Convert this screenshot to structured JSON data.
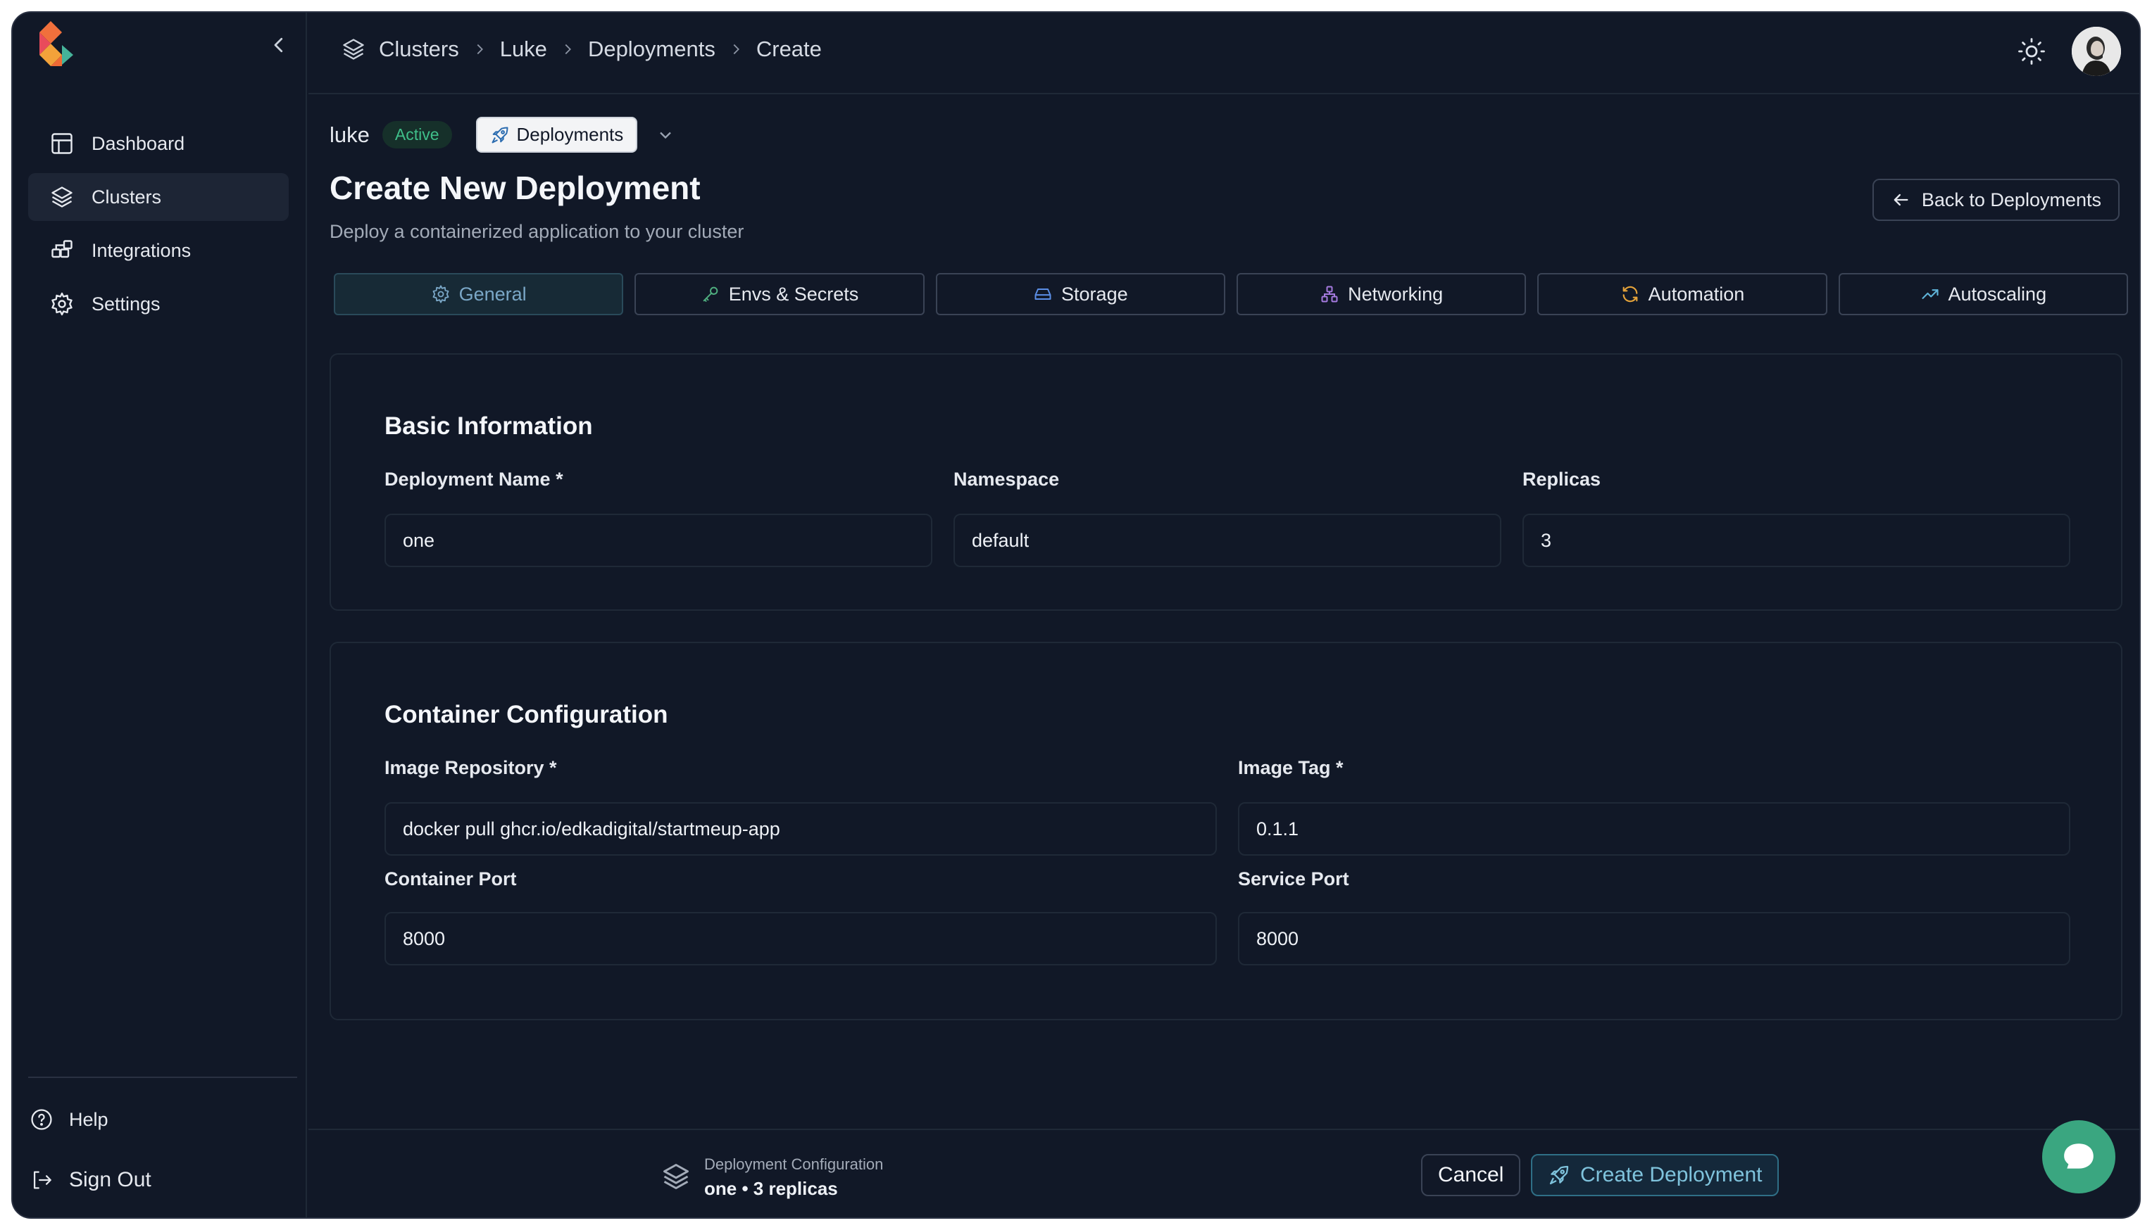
{
  "sidebar": {
    "items": [
      {
        "label": "Dashboard",
        "icon": "dashboard-icon"
      },
      {
        "label": "Clusters",
        "icon": "layers-icon",
        "active": true
      },
      {
        "label": "Integrations",
        "icon": "integrations-icon"
      },
      {
        "label": "Settings",
        "icon": "gear-icon"
      }
    ],
    "help_label": "Help",
    "signout_label": "Sign Out"
  },
  "breadcrumb": [
    "Clusters",
    "Luke",
    "Deployments",
    "Create"
  ],
  "header": {
    "cluster_name": "luke",
    "status_badge": "Active",
    "section_pill": "Deployments",
    "title": "Create New Deployment",
    "subtitle": "Deploy a containerized application to your cluster",
    "back_label": "Back to Deployments"
  },
  "tabs": [
    {
      "label": "General",
      "icon": "gear-icon",
      "active": true
    },
    {
      "label": "Envs & Secrets",
      "icon": "key-icon"
    },
    {
      "label": "Storage",
      "icon": "storage-icon"
    },
    {
      "label": "Networking",
      "icon": "network-icon"
    },
    {
      "label": "Automation",
      "icon": "refresh-icon"
    },
    {
      "label": "Autoscaling",
      "icon": "trending-up-icon"
    }
  ],
  "basic": {
    "title": "Basic Information",
    "deployment_name_label": "Deployment Name *",
    "deployment_name_value": "one",
    "namespace_label": "Namespace",
    "namespace_value": "default",
    "replicas_label": "Replicas",
    "replicas_value": "3"
  },
  "container": {
    "title": "Container Configuration",
    "image_repo_label": "Image Repository *",
    "image_repo_value": "docker pull ghcr.io/edkadigital/startmeup-app",
    "image_tag_label": "Image Tag *",
    "image_tag_value": "0.1.1",
    "container_port_label": "Container Port",
    "container_port_value": "8000",
    "service_port_label": "Service Port",
    "service_port_value": "8000"
  },
  "footer": {
    "summary_label": "Deployment Configuration",
    "summary_value": "one • 3 replicas",
    "cancel_label": "Cancel",
    "create_label": "Create Deployment"
  },
  "colors": {
    "background": "#111827",
    "accent": "#7fc3dc",
    "active_badge": "#3fbf8a",
    "chat_button": "#3aa680"
  }
}
